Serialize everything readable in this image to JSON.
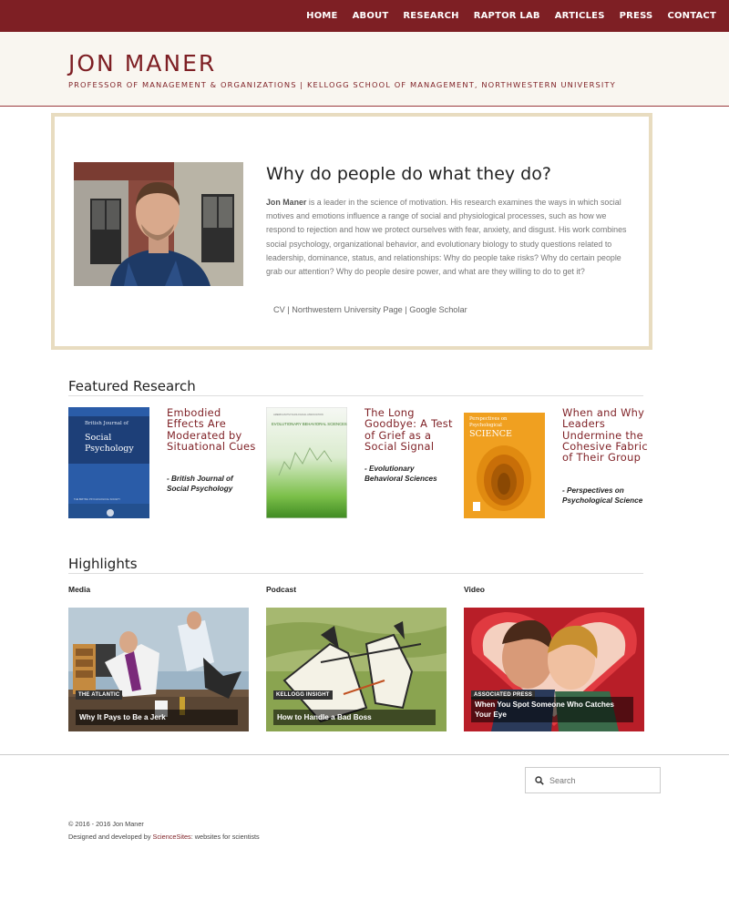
{
  "nav": {
    "items": [
      "HOME",
      "ABOUT",
      "RESEARCH",
      "RAPTOR LAB",
      "ARTICLES",
      "PRESS",
      "CONTACT"
    ]
  },
  "header": {
    "title": "JON MANER",
    "subtitle": "PROFESSOR OF MANAGEMENT & ORGANIZATIONS | KELLOGG SCHOOL OF MANAGEMENT, NORTHWESTERN UNIVERSITY"
  },
  "intro": {
    "title": "Why do people do what they do?",
    "name_bold": "Jon Maner",
    "body": " is a leader in the science of motivation. His research examines the ways in which social motives and emotions influence a range of social and physiological processes, such as how we respond to rejection and how we protect ourselves with fear, anxiety, and disgust. His work combines social psychology, organizational behavior, and evolutionary biology to study questions related to leadership, dominance, status, and relationships: Why do people take risks? Why do certain people grab our attention? Why do people desire power, and what are they willing to do to get it?",
    "links": [
      "CV",
      "Northwestern University Page",
      "Google Scholar"
    ],
    "separator": " | "
  },
  "featured": {
    "heading": "Featured Research",
    "items": [
      {
        "title": "Embodied Effects Are Moderated by Situational Cues",
        "source": "- British Journal of Social Psychology",
        "cover": {
          "journal_small": "British Journal of",
          "journal_big": "Social Psychology",
          "footer": "THE BRITISH PSYCHOLOGICAL SOCIETY"
        }
      },
      {
        "title": "The Long Goodbye: A Test of Grief as a Social Signal",
        "source": "- Evolutionary Behavioral Sciences",
        "cover": {
          "publisher": "AMERICAN PSYCHOLOGICAL ASSOCIATION",
          "journal": "EVOLUTIONARY BEHAVIORAL SCIENCES"
        }
      },
      {
        "title": "When and Why Leaders Undermine the Cohesive Fabric of Their Group",
        "source": "- Perspectives on Psychological Science",
        "cover": {
          "journal_small": "Perspectives on Psychological",
          "journal_big": "SCIENCE"
        }
      }
    ]
  },
  "highlights": {
    "heading": "Highlights",
    "items": [
      {
        "label": "Media",
        "tag": "THE ATLANTIC",
        "caption": "Why It Pays to Be a Jerk"
      },
      {
        "label": "Podcast",
        "tag": "KELLOGG INSIGHT",
        "caption": "How to Handle a Bad Boss"
      },
      {
        "label": "Video",
        "tag": "ASSOCIATED PRESS",
        "caption": "When You Spot Someone Who Catches Your Eye"
      }
    ]
  },
  "footer": {
    "search_placeholder": "Search",
    "copyright": "© 2016 - 2016 Jon Maner",
    "designed_prefix": "Designed and developed by ",
    "designed_brand": "ScienceSites",
    "designed_suffix": ": websites for scientists"
  },
  "colors": {
    "brand": "#7e1f24",
    "header_bg": "#f9f6f0",
    "intro_border": "#e8dcc0"
  }
}
